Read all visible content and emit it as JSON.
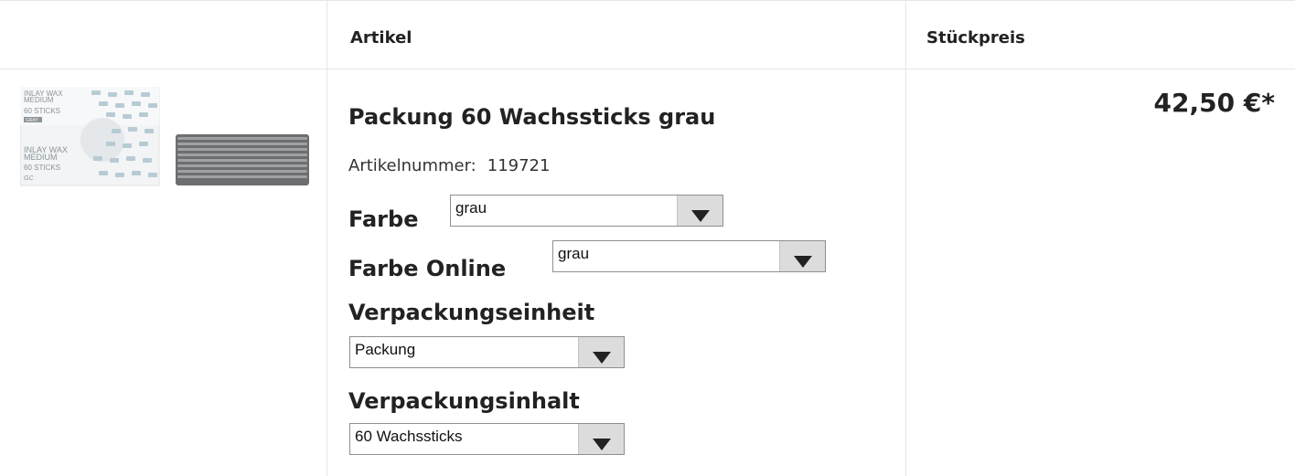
{
  "table": {
    "header": {
      "article": "Artikel",
      "unit_price": "Stückpreis"
    }
  },
  "product": {
    "image_texts": {
      "front_line1": "INLAY WAX",
      "front_line2": "MEDIUM",
      "front_line3": "60 STICKS",
      "top_line1": "INLAY WAX",
      "top_line2": "MEDIUM",
      "top_line3": "60 STICKS",
      "top_badge": "GRAY",
      "brand": "GC"
    },
    "title": "Packung 60 Wachssticks grau",
    "article_number_label": "Artikelnummer:",
    "article_number": "119721",
    "price": "42,50 €*",
    "options": [
      {
        "label": "Farbe",
        "value": "grau"
      },
      {
        "label": "Farbe Online",
        "value": "grau"
      },
      {
        "label": "Verpackungseinheit",
        "value": "Packung"
      },
      {
        "label": "Verpackungsinhalt",
        "value": "60 Wachssticks"
      }
    ]
  }
}
